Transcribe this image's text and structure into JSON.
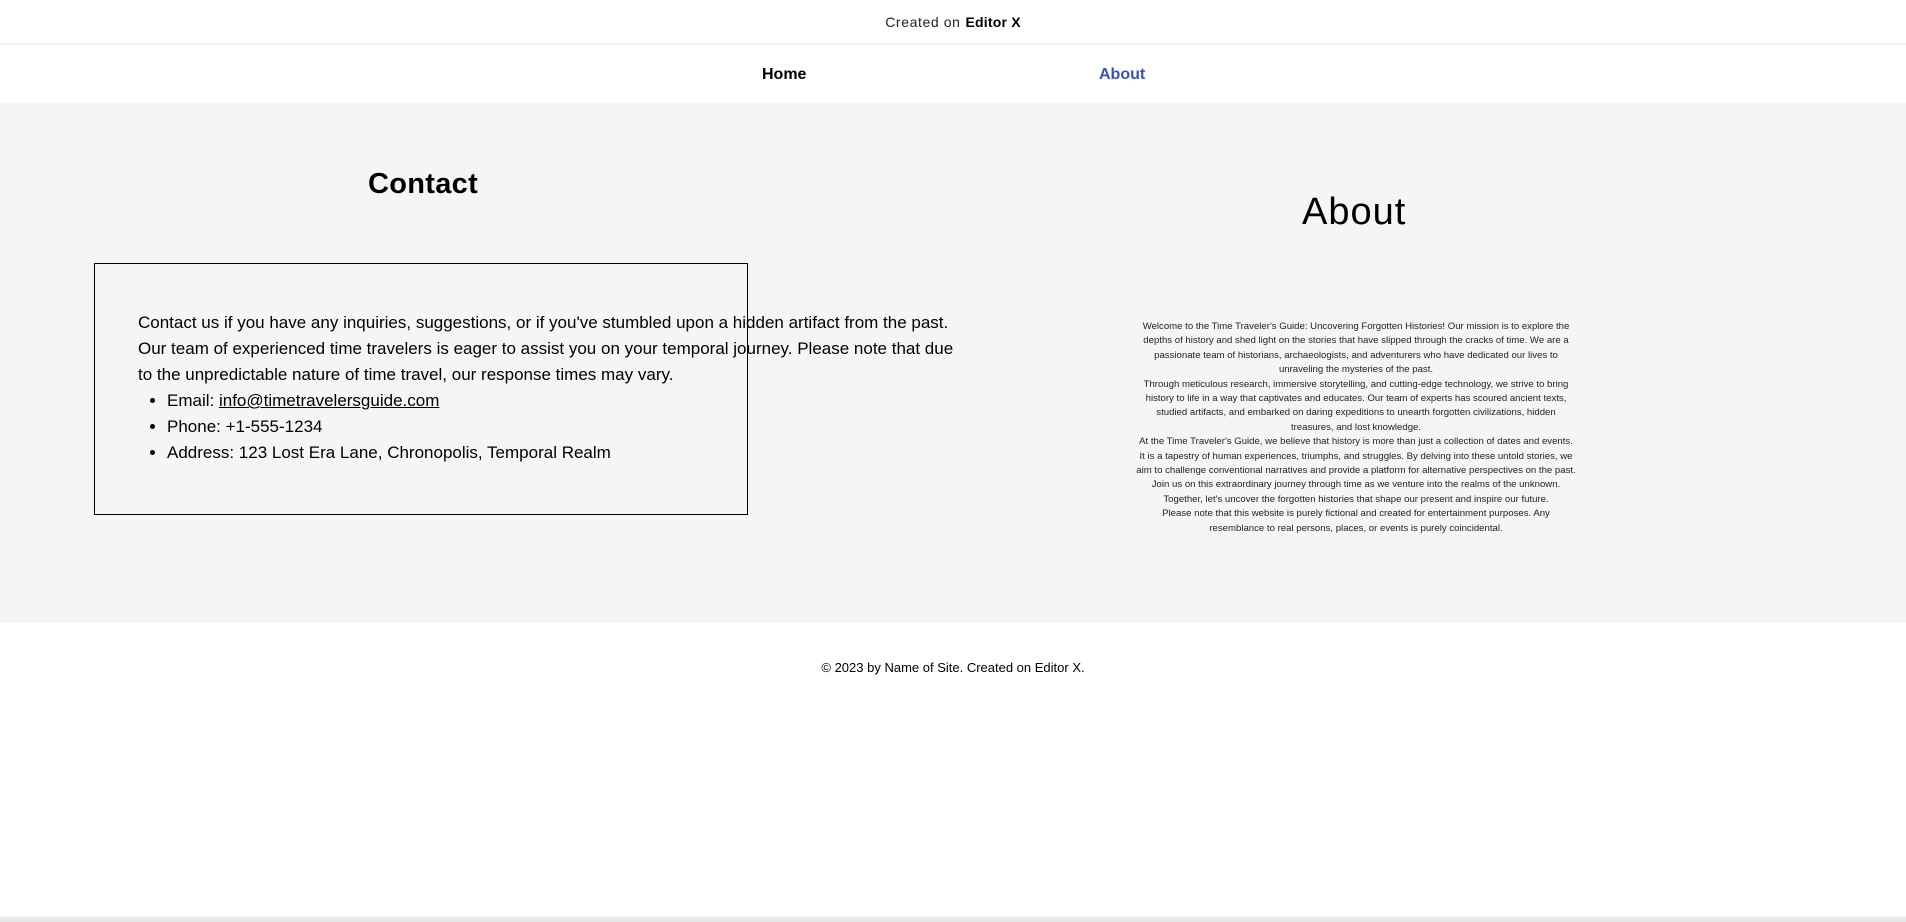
{
  "banner": {
    "prefix": "Created on",
    "brand": "Editor X"
  },
  "nav": {
    "items": [
      {
        "label": "Home"
      },
      {
        "label": "About"
      }
    ],
    "active_color": "#3b4fc4"
  },
  "contact": {
    "title": "Contact",
    "intro": "Contact us if you have any inquiries, suggestions, or if you've stumbled upon a hidden artifact from the past. Our team of experienced time travelers is eager to assist you on your temporal journey. Please note that due to the unpredictable nature of time travel, our response times may vary.",
    "email_label": "Email: ",
    "email": "info@timetravelersguide.com",
    "phone": "Phone: +1-555-1234",
    "address": "Address: 123 Lost Era Lane, Chronopolis, Temporal Realm"
  },
  "about": {
    "title": "About",
    "paragraphs": [
      "Welcome to the Time Traveler's Guide: Uncovering Forgotten Histories! Our mission is to explore the depths of history and shed light on the stories that have slipped through the cracks of time. We are a passionate team of historians, archaeologists, and adventurers who have dedicated our lives to unraveling the mysteries of the past.",
      "Through meticulous research, immersive storytelling, and cutting-edge technology, we strive to bring history to life in a way that captivates and educates. Our team of experts has scoured ancient texts, studied artifacts, and embarked on daring expeditions to unearth forgotten civilizations, hidden treasures, and lost knowledge.",
      "At the Time Traveler's Guide, we believe that history is more than just a collection of dates and events. It is a tapestry of human experiences, triumphs, and struggles. By delving into these untold stories, we aim to challenge conventional narratives and provide a platform for alternative perspectives on the past.",
      "Join us on this extraordinary journey through time as we venture into the realms of the unknown. Together, let's uncover the forgotten histories that shape our present and inspire our future.",
      "Please note that this website is purely fictional and created for entertainment purposes. Any resemblance to real persons, places, or events is purely coincidental."
    ]
  },
  "footer": {
    "text": "© 2023 by Name of Site. Created on Editor X."
  }
}
